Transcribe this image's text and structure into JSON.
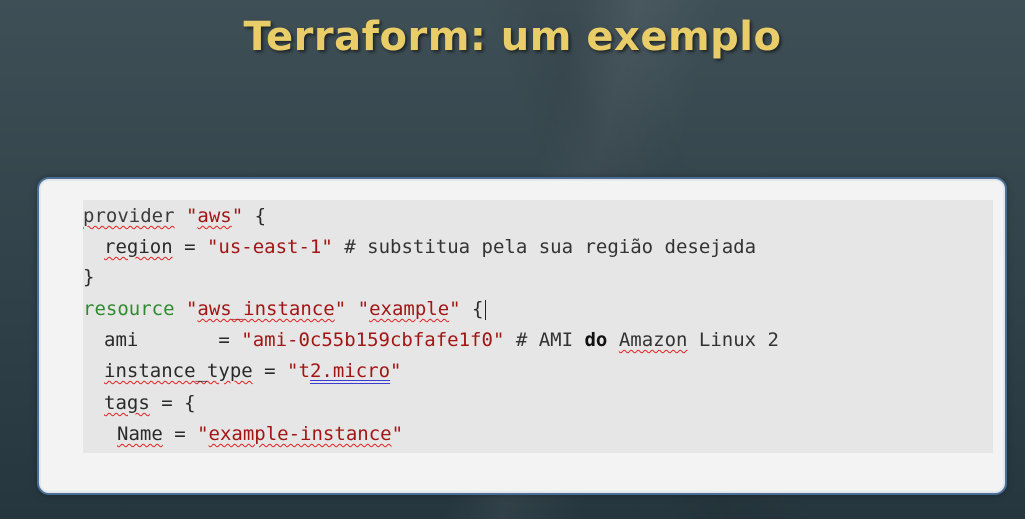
{
  "slide": {
    "title": "Terraform: um exemplo"
  },
  "code": {
    "line1": {
      "keyword": "provider",
      "space": " ",
      "q1": "\"",
      "name": "aws",
      "q2": "\"",
      "rest": " {"
    },
    "line2": {
      "key": "region",
      "eq": " = ",
      "value": "\"us-east-1\"",
      "comment": " # substitua pela sua região desejada"
    },
    "line3": {
      "text": "}"
    },
    "line4": {
      "keyword": "resource",
      "space1": " ",
      "q1": "\"",
      "type": "aws_instance",
      "q2": "\"",
      "space2": " ",
      "q3": "\"",
      "name": "example",
      "q4": "\"",
      "rest": " {"
    },
    "line5": {
      "key": "ami",
      "eq": "       = ",
      "value": "\"ami-0c55b159cbfafe1f0\"",
      "comment_pre": " # AMI ",
      "comment_bold": "do",
      "comment_space": " ",
      "comment_word": "Amazon",
      "comment_post": " Linux 2"
    },
    "line6": {
      "key": "instance_type",
      "eq": " = ",
      "q1": "\"",
      "t": "t",
      "value_underlined": "2.micro",
      "q2": "\""
    },
    "line7": {
      "key": "tags",
      "rest": " = {"
    },
    "line8": {
      "key": "Name",
      "eq": " = ",
      "q1": "\"",
      "value": "example-instance",
      "q2": "\""
    }
  }
}
